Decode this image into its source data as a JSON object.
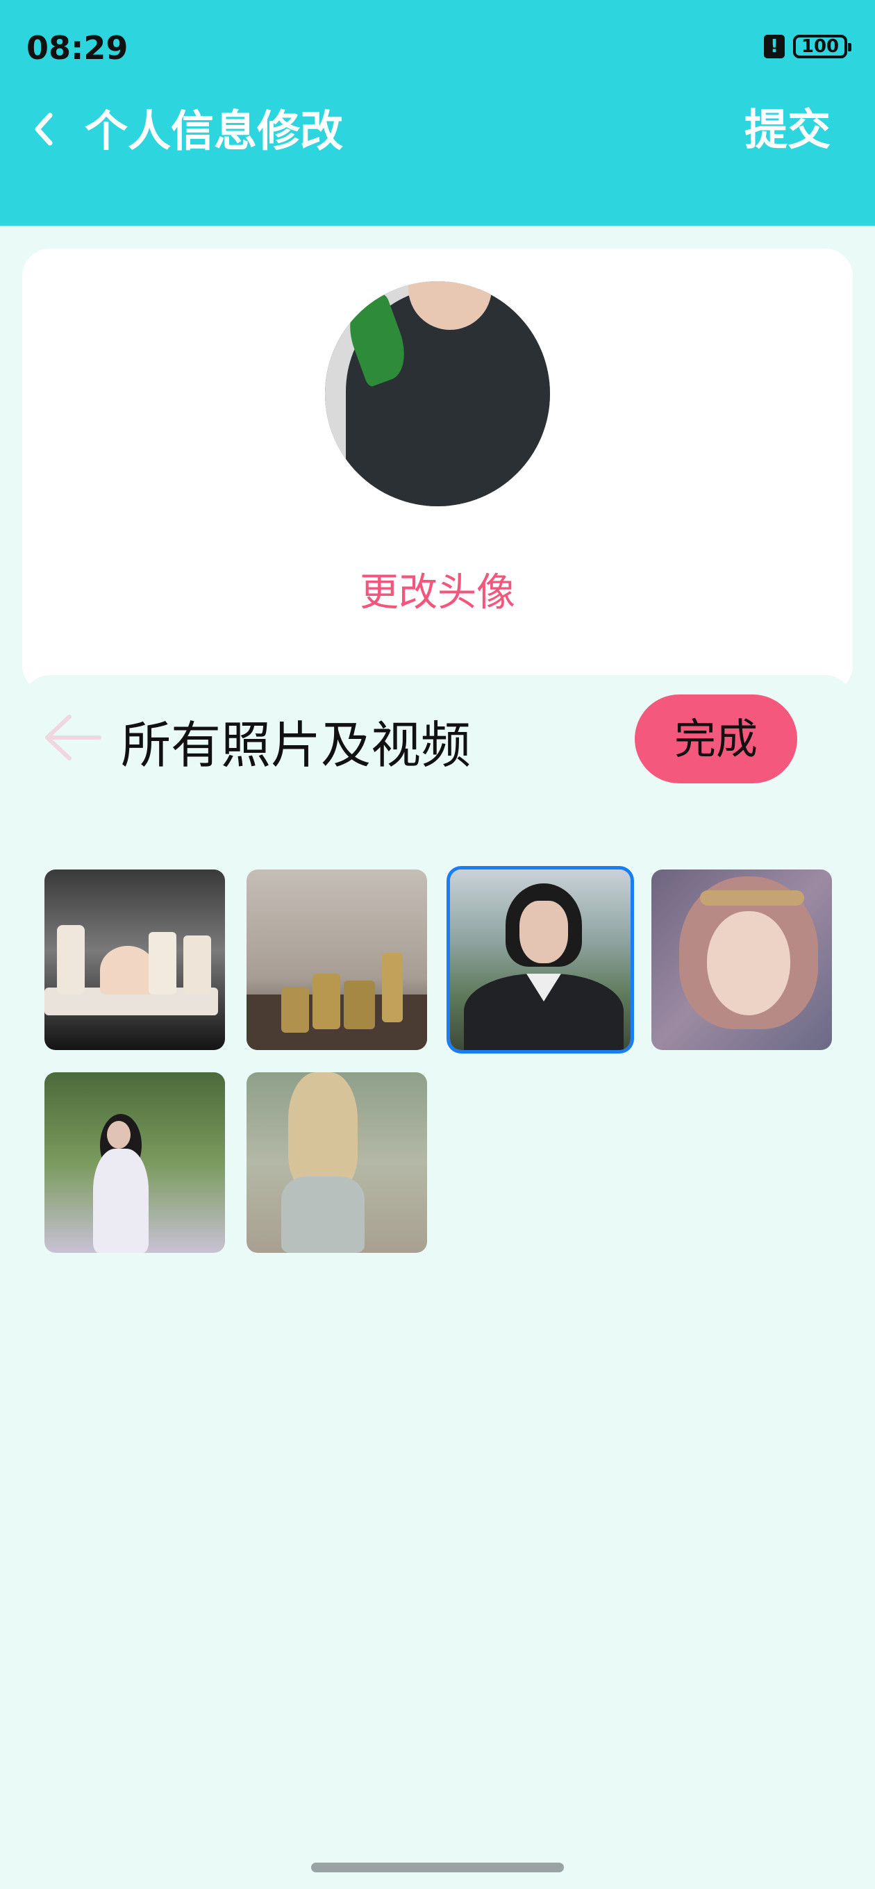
{
  "status_bar": {
    "time": "08:29",
    "battery": "100"
  },
  "header": {
    "title": "个人信息修改",
    "submit_label": "提交",
    "background": "#2dd5de"
  },
  "profile": {
    "change_avatar_label": "更改头像"
  },
  "picker": {
    "title": "所有照片及视频",
    "done_label": "完成",
    "photos": [
      {
        "name": "bathroom-accessories-photo",
        "selected": false
      },
      {
        "name": "brass-canisters-photo",
        "selected": false
      },
      {
        "name": "bob-hair-woman-photo",
        "selected": true
      },
      {
        "name": "girl-with-headband-photo",
        "selected": false
      },
      {
        "name": "woman-in-forest-photo",
        "selected": false
      },
      {
        "name": "girl-long-hair-photo",
        "selected": false
      }
    ]
  },
  "colors": {
    "accent_pink": "#f5587d",
    "selected_border": "#1a7ef0",
    "background": "#eafaf7"
  }
}
